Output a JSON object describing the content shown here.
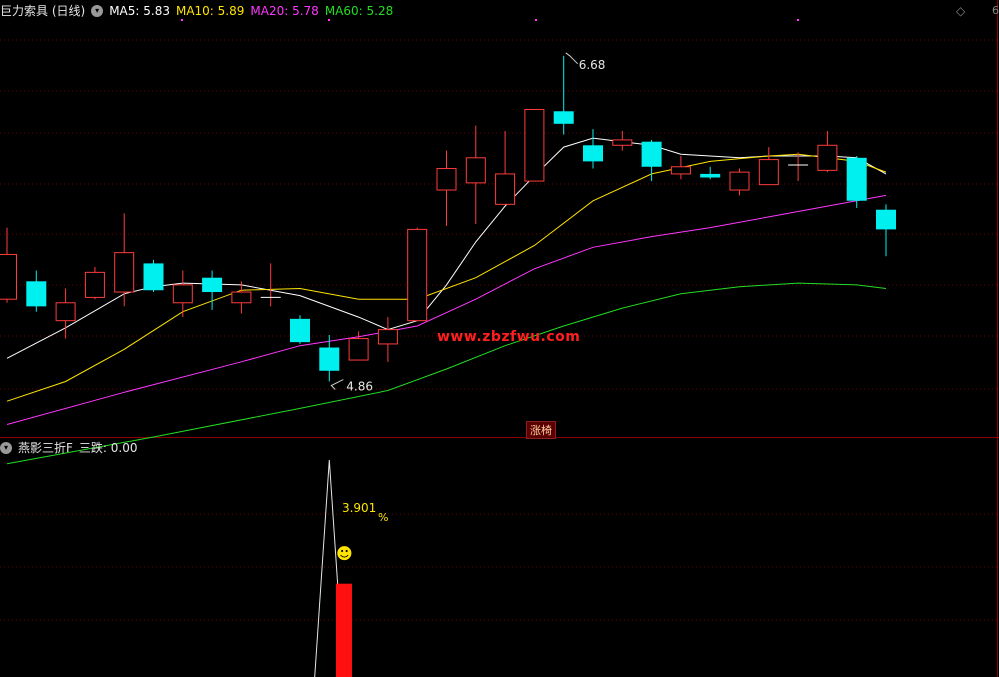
{
  "main_title": "巨力索具 (日线)",
  "ma_legend": [
    {
      "label": "MA5: 5.83",
      "color": "#ffffff"
    },
    {
      "label": "MA10: 5.89",
      "color": "#ffe500"
    },
    {
      "label": "MA20: 5.78",
      "color": "#ff37ff"
    },
    {
      "label": "MA60: 5.28",
      "color": "#22dd22"
    }
  ],
  "sub_title": "燕影三折F",
  "sub_value": "三跌: 0.00",
  "watermark": "www.zbzfwu.com",
  "limit_up_label": "涨椅",
  "corner_icon": "diamond-icon",
  "corner_text": "6",
  "colors": {
    "up": "#ff3c3c",
    "down": "#00f0f0",
    "grid": "#6a0000",
    "divider": "#8a0000"
  },
  "chart_data": [
    {
      "type": "candlestick",
      "y_range": [
        4.55,
        6.88
      ],
      "high_label": "6.68",
      "low_label": "4.86",
      "candles": [
        {
          "o": 5.32,
          "c": 5.57,
          "h": 5.72,
          "l": 5.3
        },
        {
          "o": 5.42,
          "c": 5.28,
          "h": 5.48,
          "l": 5.25
        },
        {
          "o": 5.2,
          "c": 5.3,
          "h": 5.38,
          "l": 5.1
        },
        {
          "o": 5.33,
          "c": 5.47,
          "h": 5.5,
          "l": 5.32
        },
        {
          "o": 5.36,
          "c": 5.58,
          "h": 5.8,
          "l": 5.28
        },
        {
          "o": 5.52,
          "c": 5.37,
          "h": 5.54,
          "l": 5.36
        },
        {
          "o": 5.3,
          "c": 5.4,
          "h": 5.48,
          "l": 5.22
        },
        {
          "o": 5.44,
          "c": 5.36,
          "h": 5.48,
          "l": 5.26
        },
        {
          "o": 5.3,
          "c": 5.36,
          "h": 5.42,
          "l": 5.24
        },
        {
          "o": 5.33,
          "c": 5.33,
          "h": 5.52,
          "l": 5.28
        },
        {
          "o": 5.21,
          "c": 5.08,
          "h": 5.23,
          "l": 5.07
        },
        {
          "o": 5.05,
          "c": 4.92,
          "h": 5.12,
          "l": 4.86
        },
        {
          "o": 4.98,
          "c": 5.1,
          "h": 5.14,
          "l": 4.98
        },
        {
          "o": 5.07,
          "c": 5.15,
          "h": 5.22,
          "l": 4.97
        },
        {
          "o": 5.2,
          "c": 5.71,
          "h": 5.72,
          "l": 5.2
        },
        {
          "o": 5.93,
          "c": 6.05,
          "h": 6.15,
          "l": 5.73
        },
        {
          "o": 5.97,
          "c": 6.11,
          "h": 6.29,
          "l": 5.74
        },
        {
          "o": 5.85,
          "c": 6.02,
          "h": 6.26,
          "l": 5.85
        },
        {
          "o": 5.98,
          "c": 6.38,
          "h": 6.38,
          "l": 5.98
        },
        {
          "o": 6.37,
          "c": 6.3,
          "h": 6.68,
          "l": 6.24
        },
        {
          "o": 6.18,
          "c": 6.09,
          "h": 6.27,
          "l": 6.05
        },
        {
          "o": 6.18,
          "c": 6.21,
          "h": 6.26,
          "l": 6.15
        },
        {
          "o": 6.2,
          "c": 6.06,
          "h": 6.21,
          "l": 5.98
        },
        {
          "o": 6.02,
          "c": 6.06,
          "h": 6.12,
          "l": 5.99
        },
        {
          "o": 6.02,
          "c": 6.0,
          "h": 6.06,
          "l": 5.99
        },
        {
          "o": 5.93,
          "c": 6.03,
          "h": 6.05,
          "l": 5.9
        },
        {
          "o": 5.96,
          "c": 6.1,
          "h": 6.17,
          "l": 5.96
        },
        {
          "o": 6.07,
          "c": 6.07,
          "h": 6.14,
          "l": 5.98
        },
        {
          "o": 6.04,
          "c": 6.18,
          "h": 6.26,
          "l": 6.03
        },
        {
          "o": 6.11,
          "c": 5.87,
          "h": 6.12,
          "l": 5.83
        },
        {
          "o": 5.82,
          "c": 5.71,
          "h": 5.85,
          "l": 5.56
        }
      ],
      "ma_lines": [
        {
          "name": "MA5",
          "color": "#ffffff",
          "x": [
            0,
            2,
            4,
            5,
            6,
            8,
            10,
            12,
            13,
            14,
            15,
            16,
            17,
            18,
            19,
            20,
            21,
            22,
            23,
            24,
            25,
            26,
            27,
            28,
            29,
            30
          ],
          "y": [
            4.99,
            5.16,
            5.35,
            5.39,
            5.41,
            5.4,
            5.34,
            5.22,
            5.15,
            5.2,
            5.4,
            5.64,
            5.84,
            6.01,
            6.17,
            6.22,
            6.2,
            6.18,
            6.13,
            6.12,
            6.11,
            6.12,
            6.12,
            6.12,
            6.11,
            6.02
          ]
        },
        {
          "name": "MA10",
          "color": "#ffe500",
          "x": [
            0,
            2,
            4,
            6,
            8,
            10,
            12,
            14,
            16,
            18,
            20,
            22,
            24,
            26,
            27,
            28,
            29,
            30
          ],
          "y": [
            4.75,
            4.86,
            5.04,
            5.25,
            5.37,
            5.38,
            5.32,
            5.32,
            5.44,
            5.62,
            5.87,
            6.02,
            6.09,
            6.12,
            6.13,
            6.11,
            6.09,
            6.03
          ]
        },
        {
          "name": "MA20",
          "color": "#ff37ff",
          "x": [
            0,
            4,
            8,
            10,
            12,
            14,
            16,
            18,
            20,
            22,
            24,
            26,
            28,
            30
          ],
          "y": [
            4.62,
            4.8,
            4.97,
            5.06,
            5.11,
            5.17,
            5.32,
            5.49,
            5.61,
            5.67,
            5.72,
            5.78,
            5.84,
            5.9
          ]
        },
        {
          "name": "MA60",
          "color": "#22dd22",
          "x": [
            0,
            5,
            10,
            13,
            15,
            17,
            19,
            21,
            23,
            25,
            27,
            29,
            30
          ],
          "y": [
            4.4,
            4.55,
            4.71,
            4.81,
            4.93,
            5.06,
            5.17,
            5.27,
            5.35,
            5.39,
            5.41,
            5.4,
            5.38
          ]
        }
      ]
    },
    {
      "type": "indicator",
      "series": [
        {
          "x": [
            10.5,
            11,
            11.5
          ],
          "y": [
            0,
            1,
            0
          ]
        }
      ],
      "bar": {
        "x": 11.5,
        "value": 0.43
      },
      "label": "3.901",
      "label_unit": "%",
      "marker_icon": "smiley-icon",
      "marker_glyph": "☻"
    }
  ]
}
